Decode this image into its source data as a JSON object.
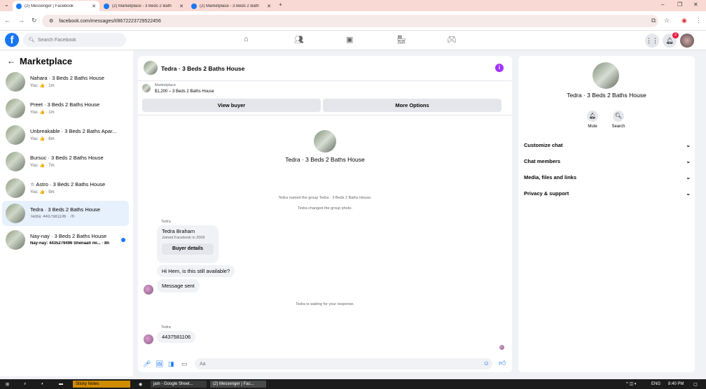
{
  "browser": {
    "tabs": [
      {
        "title": "(2) Messenger | Facebook",
        "active": true
      },
      {
        "title": "(2) Marketplace - 3 Beds 2 Bath",
        "active": false
      },
      {
        "title": "(2) Marketplace - 3 Beds 2 Bath",
        "active": false
      }
    ],
    "url": "facebook.com/messages/t/8672223729522456"
  },
  "header": {
    "search_placeholder": "Search Facebook",
    "notification_count": "2"
  },
  "sidebar": {
    "title": "Marketplace",
    "conversations": [
      {
        "name": "Nahara · 3 Beds 2 Baths House",
        "sub": "You: 👍 · 1m",
        "selected": false,
        "unread": false
      },
      {
        "name": "Preet · 3 Beds 2 Baths House",
        "sub": "You: 👍 · 1m",
        "selected": false,
        "unread": false
      },
      {
        "name": "Unbreakable · 3 Beds 2 Baths Apar...",
        "sub": "You: 👍 · 6m",
        "selected": false,
        "unread": false
      },
      {
        "name": "Bursuc · 3 Beds 2 Baths House",
        "sub": "You: 👍 · 7m",
        "selected": false,
        "unread": false
      },
      {
        "name": "☆ Astro · 3 Beds 2 Baths House",
        "sub": "You: 👍 · 9m",
        "selected": false,
        "unread": false
      },
      {
        "name": "Tedra · 3 Beds 2 Baths House",
        "sub": "Tedra: 4437581106 · 7h",
        "selected": true,
        "unread": false
      },
      {
        "name": "Nay-nay · 3 Beds 2 Baths House",
        "sub": "Nay-nay: 4435279496 Shenaah mi... · 8h",
        "selected": false,
        "unread": true
      }
    ]
  },
  "chat": {
    "title": "Tedra · 3 Beds 2 Baths House",
    "listing_source": "Marketplace",
    "listing_price": "$1,200 – 3 Beds 2 Baths House",
    "view_buyer_label": "View buyer",
    "more_options_label": "More Options",
    "center_title": "Tedra · 3 Beds 2 Baths House",
    "system_messages": [
      "Tedra named the group Tedra · 3 Beds 2 Baths House.",
      "Tedra changed the group photo.",
      "Tedra is waiting for your response."
    ],
    "sender_label": "Tedra",
    "buyer_card": {
      "name": "Tedra Braham",
      "joined": "Joined Facebook in 2009",
      "button": "Buyer details"
    },
    "messages": [
      "Hi Hem, is this still available?",
      "Message sent"
    ],
    "sender_label_2": "Tedra",
    "last_message": "4437581106",
    "composer_placeholder": "Aa"
  },
  "details": {
    "title": "Tedra · 3 Beds 2 Baths House",
    "mute_label": "Mute",
    "search_label": "Search",
    "rows": [
      "Customize chat",
      "Chat members",
      "Media, files and links",
      "Privacy & support"
    ]
  },
  "taskbar": {
    "items": [
      "Sticky Notes",
      "jam - Google Sheet...",
      "(2) Messenger | Fac..."
    ],
    "lang": "ENG",
    "time": "8:40 PM"
  },
  "colors": {
    "accent": "#1877f2",
    "selected_bg": "#e7f0fd",
    "info": "#a033ff"
  }
}
